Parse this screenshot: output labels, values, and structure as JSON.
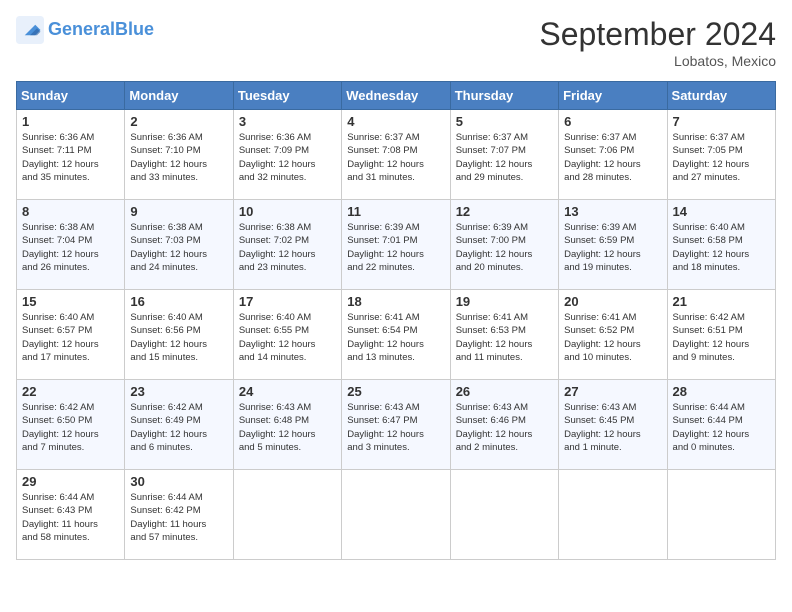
{
  "header": {
    "logo_text_general": "General",
    "logo_text_blue": "Blue",
    "month_title": "September 2024",
    "location": "Lobatos, Mexico"
  },
  "weekdays": [
    "Sunday",
    "Monday",
    "Tuesday",
    "Wednesday",
    "Thursday",
    "Friday",
    "Saturday"
  ],
  "weeks": [
    [
      {
        "day": "1",
        "info": "Sunrise: 6:36 AM\nSunset: 7:11 PM\nDaylight: 12 hours\nand 35 minutes."
      },
      {
        "day": "2",
        "info": "Sunrise: 6:36 AM\nSunset: 7:10 PM\nDaylight: 12 hours\nand 33 minutes."
      },
      {
        "day": "3",
        "info": "Sunrise: 6:36 AM\nSunset: 7:09 PM\nDaylight: 12 hours\nand 32 minutes."
      },
      {
        "day": "4",
        "info": "Sunrise: 6:37 AM\nSunset: 7:08 PM\nDaylight: 12 hours\nand 31 minutes."
      },
      {
        "day": "5",
        "info": "Sunrise: 6:37 AM\nSunset: 7:07 PM\nDaylight: 12 hours\nand 29 minutes."
      },
      {
        "day": "6",
        "info": "Sunrise: 6:37 AM\nSunset: 7:06 PM\nDaylight: 12 hours\nand 28 minutes."
      },
      {
        "day": "7",
        "info": "Sunrise: 6:37 AM\nSunset: 7:05 PM\nDaylight: 12 hours\nand 27 minutes."
      }
    ],
    [
      {
        "day": "8",
        "info": "Sunrise: 6:38 AM\nSunset: 7:04 PM\nDaylight: 12 hours\nand 26 minutes."
      },
      {
        "day": "9",
        "info": "Sunrise: 6:38 AM\nSunset: 7:03 PM\nDaylight: 12 hours\nand 24 minutes."
      },
      {
        "day": "10",
        "info": "Sunrise: 6:38 AM\nSunset: 7:02 PM\nDaylight: 12 hours\nand 23 minutes."
      },
      {
        "day": "11",
        "info": "Sunrise: 6:39 AM\nSunset: 7:01 PM\nDaylight: 12 hours\nand 22 minutes."
      },
      {
        "day": "12",
        "info": "Sunrise: 6:39 AM\nSunset: 7:00 PM\nDaylight: 12 hours\nand 20 minutes."
      },
      {
        "day": "13",
        "info": "Sunrise: 6:39 AM\nSunset: 6:59 PM\nDaylight: 12 hours\nand 19 minutes."
      },
      {
        "day": "14",
        "info": "Sunrise: 6:40 AM\nSunset: 6:58 PM\nDaylight: 12 hours\nand 18 minutes."
      }
    ],
    [
      {
        "day": "15",
        "info": "Sunrise: 6:40 AM\nSunset: 6:57 PM\nDaylight: 12 hours\nand 17 minutes."
      },
      {
        "day": "16",
        "info": "Sunrise: 6:40 AM\nSunset: 6:56 PM\nDaylight: 12 hours\nand 15 minutes."
      },
      {
        "day": "17",
        "info": "Sunrise: 6:40 AM\nSunset: 6:55 PM\nDaylight: 12 hours\nand 14 minutes."
      },
      {
        "day": "18",
        "info": "Sunrise: 6:41 AM\nSunset: 6:54 PM\nDaylight: 12 hours\nand 13 minutes."
      },
      {
        "day": "19",
        "info": "Sunrise: 6:41 AM\nSunset: 6:53 PM\nDaylight: 12 hours\nand 11 minutes."
      },
      {
        "day": "20",
        "info": "Sunrise: 6:41 AM\nSunset: 6:52 PM\nDaylight: 12 hours\nand 10 minutes."
      },
      {
        "day": "21",
        "info": "Sunrise: 6:42 AM\nSunset: 6:51 PM\nDaylight: 12 hours\nand 9 minutes."
      }
    ],
    [
      {
        "day": "22",
        "info": "Sunrise: 6:42 AM\nSunset: 6:50 PM\nDaylight: 12 hours\nand 7 minutes."
      },
      {
        "day": "23",
        "info": "Sunrise: 6:42 AM\nSunset: 6:49 PM\nDaylight: 12 hours\nand 6 minutes."
      },
      {
        "day": "24",
        "info": "Sunrise: 6:43 AM\nSunset: 6:48 PM\nDaylight: 12 hours\nand 5 minutes."
      },
      {
        "day": "25",
        "info": "Sunrise: 6:43 AM\nSunset: 6:47 PM\nDaylight: 12 hours\nand 3 minutes."
      },
      {
        "day": "26",
        "info": "Sunrise: 6:43 AM\nSunset: 6:46 PM\nDaylight: 12 hours\nand 2 minutes."
      },
      {
        "day": "27",
        "info": "Sunrise: 6:43 AM\nSunset: 6:45 PM\nDaylight: 12 hours\nand 1 minute."
      },
      {
        "day": "28",
        "info": "Sunrise: 6:44 AM\nSunset: 6:44 PM\nDaylight: 12 hours\nand 0 minutes."
      }
    ],
    [
      {
        "day": "29",
        "info": "Sunrise: 6:44 AM\nSunset: 6:43 PM\nDaylight: 11 hours\nand 58 minutes."
      },
      {
        "day": "30",
        "info": "Sunrise: 6:44 AM\nSunset: 6:42 PM\nDaylight: 11 hours\nand 57 minutes."
      },
      {
        "day": "",
        "info": ""
      },
      {
        "day": "",
        "info": ""
      },
      {
        "day": "",
        "info": ""
      },
      {
        "day": "",
        "info": ""
      },
      {
        "day": "",
        "info": ""
      }
    ]
  ]
}
